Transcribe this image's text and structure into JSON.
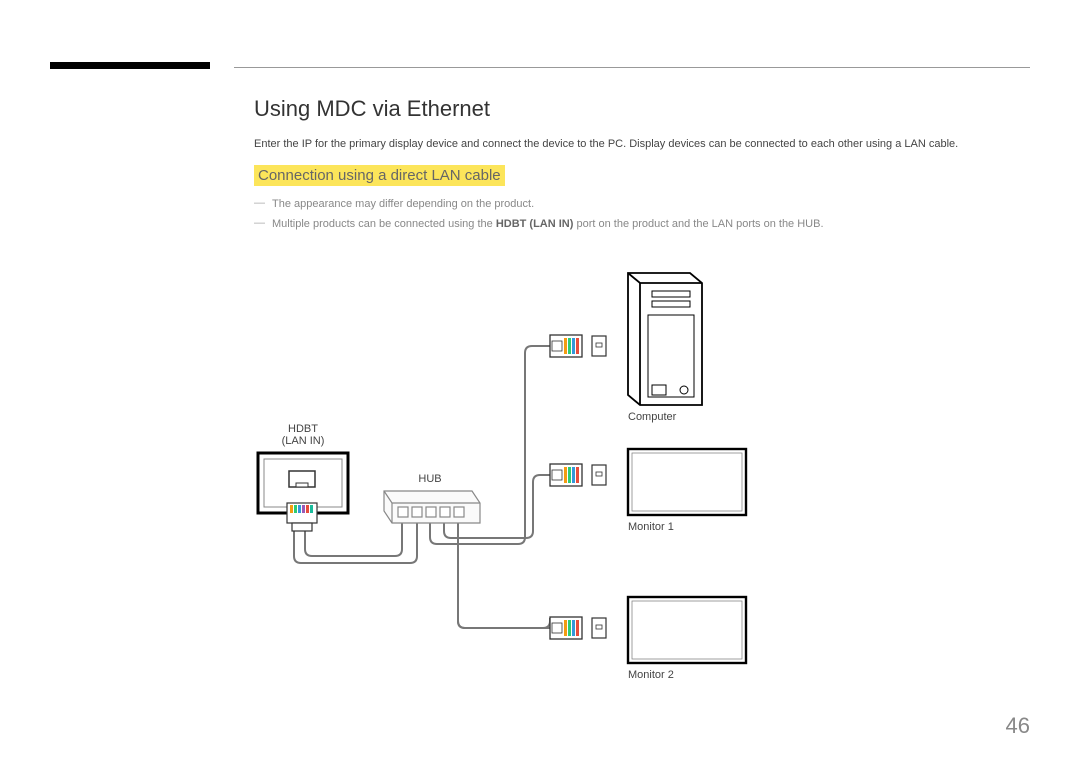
{
  "heading": "Using MDC via Ethernet",
  "intro": "Enter the IP for the primary display device and connect the device to the PC. Display devices can be connected to each other using a LAN cable.",
  "subheading": "Connection using a direct LAN cable",
  "notes": [
    {
      "text_before": "The appearance may differ depending on the product.",
      "bold": "",
      "text_after": ""
    },
    {
      "text_before": "Multiple products can be connected using the ",
      "bold": "HDBT (LAN IN)",
      "text_after": " port on the product and the LAN ports on the HUB."
    }
  ],
  "labels": {
    "hdbt": "HDBT",
    "lanin": "(LAN IN)",
    "hub": "HUB",
    "computer": "Computer",
    "monitor1": "Monitor 1",
    "monitor2": "Monitor 2"
  },
  "page": "46"
}
